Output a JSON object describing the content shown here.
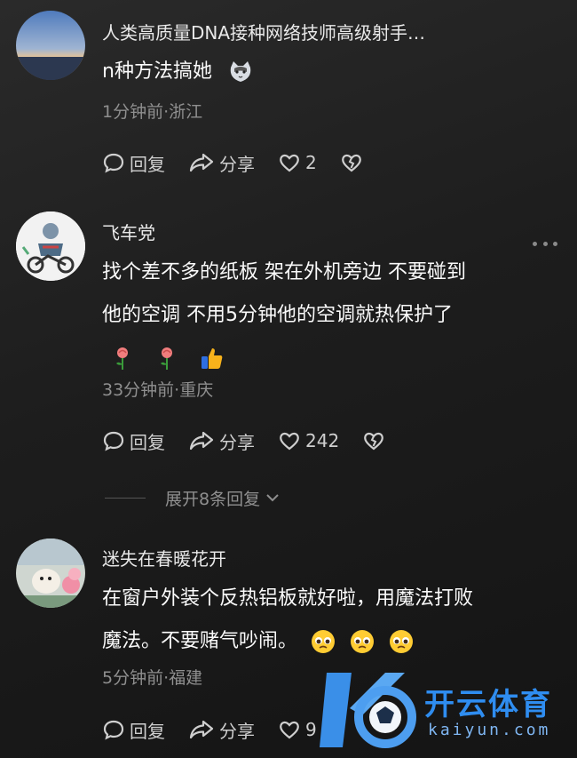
{
  "comments": [
    {
      "username": "人类高质量DNA接种网络技师高级射手…",
      "text": "n种方法搞她",
      "meta": "1分钟前·浙江",
      "reply_label": "回复",
      "share_label": "分享",
      "likes": "2"
    },
    {
      "username": "飞车党",
      "text_line1": "找个差不多的纸板 架在外机旁边 不要碰到",
      "text_line2": "他的空调 不用5分钟他的空调就热保护了",
      "meta": "33分钟前·重庆",
      "reply_label": "回复",
      "share_label": "分享",
      "likes": "242"
    },
    {
      "username": "迷失在春暖花开",
      "text_line1": "在窗户外装个反热铝板就好啦，用魔法打败",
      "text_line2": "魔法。不要赌气吵闹。",
      "meta": "5分钟前·福建",
      "reply_label": "回复",
      "share_label": "分享",
      "likes": "9"
    }
  ],
  "expand_replies": "展开8条回复",
  "watermark": {
    "brand": "开云体育",
    "domain": "kaiyun.com"
  },
  "colors": {
    "background": "#1d1d1d",
    "meta_text": "#8f8f8f",
    "watermark_blue": "#2f8df0"
  }
}
